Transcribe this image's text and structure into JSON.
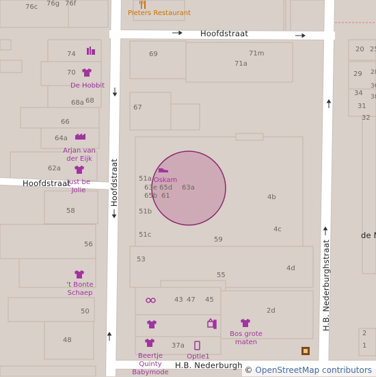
{
  "map": {
    "street_labels": {
      "hoofdstraat_top": "Hoofdstraat",
      "hoofdstraat_left": "Hoofdstraat",
      "hoofdstraat_vertical": "Hoofdstraat",
      "nederburghstraat": "H.B. Nederburghstraat",
      "nederburgh_bottom": "H.B. Nederburgh",
      "partial_right": "de N"
    },
    "house_numbers": [
      "76c",
      "76g",
      "76f",
      "74",
      "70",
      "68a",
      "68",
      "66",
      "64a",
      "62a",
      "58",
      "56",
      "50",
      "48",
      "69",
      "71m",
      "71a",
      "67",
      "51a",
      "63e",
      "65d",
      "63a",
      "65b",
      "61",
      "51b",
      "51c",
      "59",
      "4b",
      "4c",
      "53",
      "55",
      "4d",
      "43",
      "47",
      "45",
      "2d",
      "37a",
      "20",
      "25",
      "29",
      "34",
      "31",
      "32",
      "2",
      "1"
    ],
    "pois": {
      "pieters": "Pieters Restaurant",
      "de_hobbit": "De Hobbit",
      "arjan": "Arjan van der Eijk",
      "just_be_jolie": "Just be Jolie",
      "oskam": "Oskam",
      "bonte_schaep": "'t Bonte Schaep",
      "bos_grote_maten": "Bos grote maten",
      "beertje": "Beertje Quinty Babymode",
      "optie1": "Optie1"
    },
    "colors": {
      "background": "#d9d0c9",
      "building": "#d9d0c9",
      "building_stroke": "#c4b6ab",
      "road": "#ffffff",
      "road_casing": "#cdc6c2",
      "poi_shop": "#a0359e",
      "poi_food": "#c77400",
      "highlight_fill": "#c58aa8",
      "highlight_stroke": "#8a2a6e"
    },
    "icons": [
      "restaurant-icon",
      "clothes-icon",
      "bookmaker-icon",
      "tools-icon",
      "shoe-icon",
      "optician-icon",
      "mobile-phone-icon",
      "museum-icon"
    ]
  },
  "attribution": {
    "copyright": "©",
    "text": "OpenStreetMap contributors"
  }
}
